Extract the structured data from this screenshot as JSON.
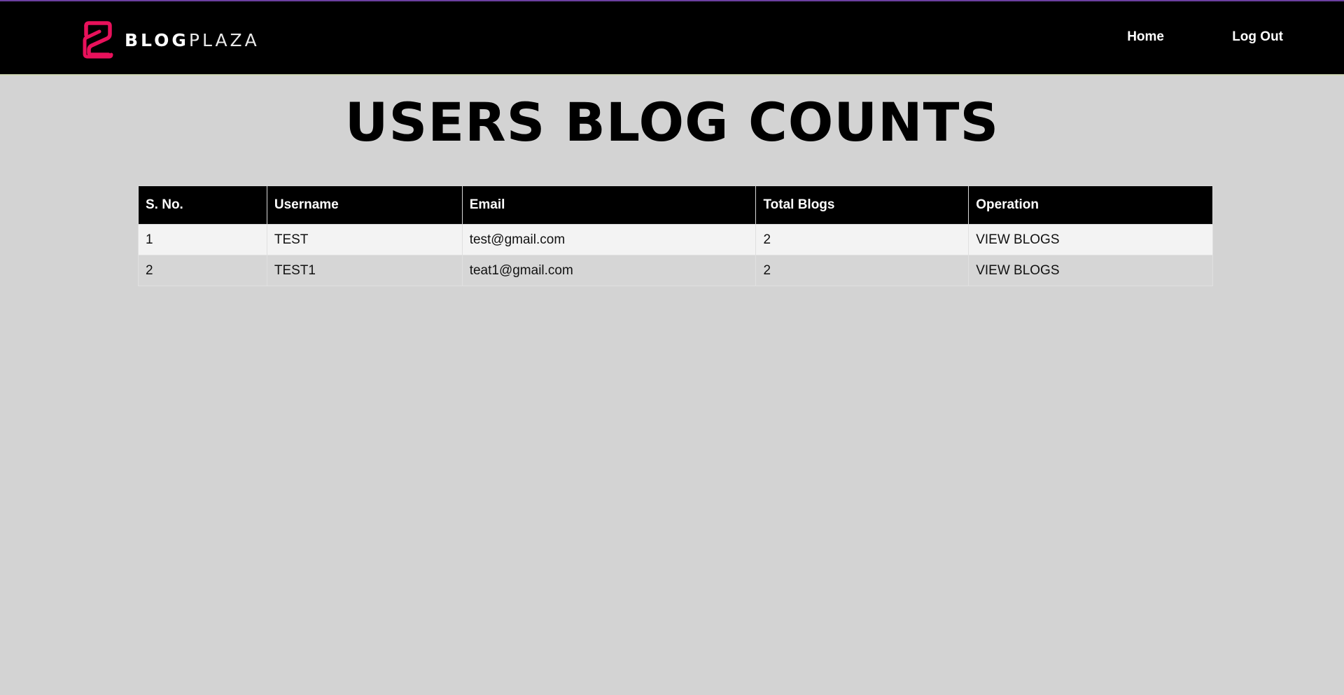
{
  "header": {
    "brand": {
      "icon": "blogplaza-logo-icon",
      "name_bold": "BLOG",
      "name_light": "PLAZA",
      "accent_color": "#e8115b"
    },
    "nav": {
      "home": "Home",
      "logout": "Log Out"
    }
  },
  "main": {
    "title": "USERS BLOG COUNTS",
    "table": {
      "columns": [
        "S. No.",
        "Username",
        "Email",
        "Total Blogs",
        "Operation"
      ],
      "rows": [
        {
          "sno": "1",
          "username": "TEST",
          "email": "test@gmail.com",
          "total": "2",
          "operation": "VIEW BLOGS"
        },
        {
          "sno": "2",
          "username": "TEST1",
          "email": "teat1@gmail.com",
          "total": "2",
          "operation": "VIEW BLOGS"
        }
      ]
    }
  },
  "colors": {
    "page_background": "#d3d3d3",
    "navbar_background": "#000000",
    "header_row_background": "#000000"
  }
}
